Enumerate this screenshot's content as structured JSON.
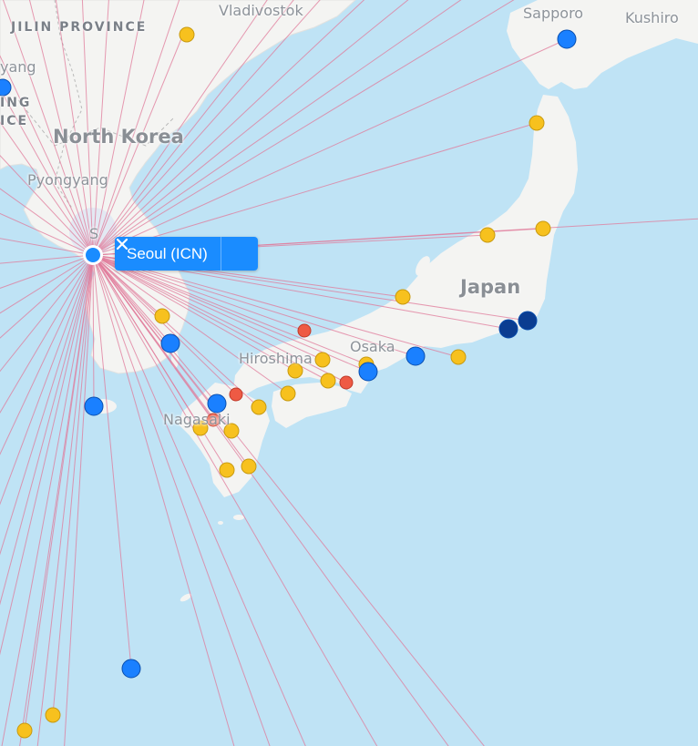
{
  "labels": {
    "jilin": "JILIN PROVINCE",
    "yang": "yang",
    "ing": "ING",
    "ice": "ICE",
    "north_korea": "North Korea",
    "pyongyang": "Pyongyang",
    "vladivostok": "Vladivostok",
    "sapporo": "Sapporo",
    "kushiro": "Kushiro",
    "japan": "Japan",
    "hiroshima": "Hiroshima",
    "osaka": "Osaka",
    "nagasaki": "Nagasaki",
    "seoul_partial": "S"
  },
  "popup": {
    "label": "Seoul (ICN)",
    "close_icon": "close-icon"
  },
  "colors": {
    "water": "#bfe3f5",
    "land": "#f4f4f2",
    "route": "#e07a9a",
    "hub": "#1a8cff",
    "marker_yellow": "#f7c11e",
    "marker_blue": "#1a80ff",
    "marker_navy": "#0b3d91",
    "marker_red": "#ee5a44"
  }
}
